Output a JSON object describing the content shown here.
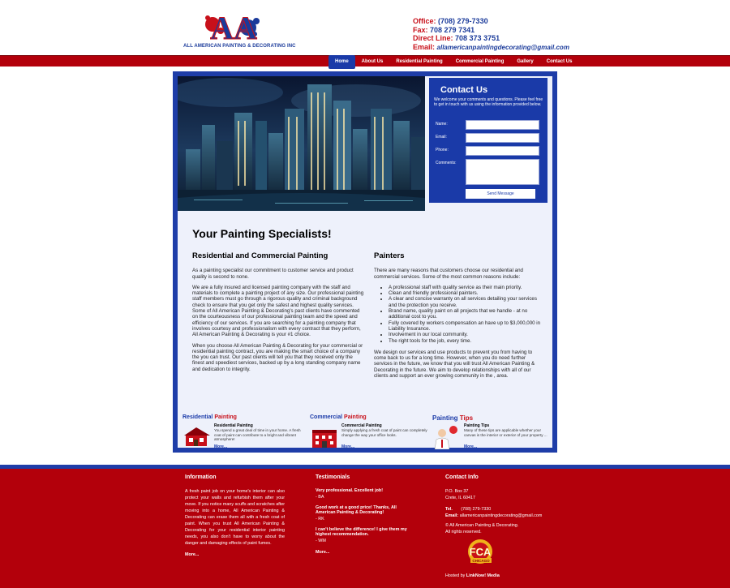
{
  "logo": {
    "text": "ALL AMERICAN PAINTING & DECORATING INC",
    "letters": "AA"
  },
  "contact_top": {
    "office_label": "Office:",
    "office": "(708) 279-7330",
    "fax_label": "Fax:",
    "fax": "708 279 7341",
    "direct_label": "Direct Line:",
    "direct": "708 373 3751",
    "email_label": "Email:",
    "email": "allamericanpaintingdecorating@gmail.com"
  },
  "nav": [
    "Home",
    "About Us",
    "Residential Painting",
    "Commercial Painting",
    "Gallery",
    "Contact Us"
  ],
  "contact_form": {
    "title": "Contact Us",
    "description": "We welcome your comments and questions. Please feel free to get in touch with us using the information provided below.",
    "labels": [
      "Name:",
      "Email:",
      "Phone:",
      "Comments:"
    ],
    "button": "Send Message"
  },
  "main": {
    "heading": "Your Painting Specialists!",
    "left": {
      "title": "Residential and Commercial Painting",
      "p1": "As a painting specialist our commitment to customer service and product quality is second to none.",
      "p2": "We are a fully insured and licensed painting company with the staff and materials to complete a painting project of any size. Our professional painting staff members must go through a rigorous quality and criminal background check to ensure that you get only the safest and highest quality services. Some of All American Painting & Decorating's past clients have commented on the courteousness of our professional painting team and the speed and efficiency of our services. If you are searching for a painting company that involves courtesy and professionalism with every contract that they perform, All American Painting & Decorating is your #1 choice.",
      "p3": "When you choose All American Painting & Decorating for your commercial or residential painting contract, you are making the smart choice of a company the you can trust. Our past clients will tell you that they received only the finest and speediest services, backed up by a long standing company name and dedication to integrity."
    },
    "right": {
      "title": "Painters",
      "p1": "There are many reasons that customers choose our residential and commercial services. Some of the most common reasons include:",
      "list": [
        "A professional staff with quality service as their main priority.",
        "Clean and friendly professional painters.",
        "A clear and concise warranty on all services detailing your services and the protection you receive.",
        "Brand name, quality paint on all projects that we handle - at no additional cost to you.",
        "Fully covered by workers compensation an have up to $3,000,000 in Liability Insurance.",
        "Involvement in our local community.",
        "The right tools for the job, every time."
      ],
      "p2": "We design our services and use products to prevent you from having to come back to us for a long time. However, when you do need further services in the future, we know that you will trust All American Painting & Decorating in the future. We aim to develop relationships with all of our clients and support an ever growing community in the , area."
    }
  },
  "features": [
    {
      "title_a": "Residential",
      "title_b": "Painting",
      "sub": "Residential Painting",
      "text": "You spend a great deal of time in your home. A fresh coat of paint can contribute to a bright and vibrant atmosphere!",
      "more": "More..."
    },
    {
      "title_a": "Commercial",
      "title_b": "Painting",
      "sub": "Commercial Painting",
      "text": "Simply applying a fresh coat of paint can completely change the way your office looks.",
      "more": "More..."
    },
    {
      "title_a": "Painting",
      "title_b": "Tips",
      "sub": "Painting Tips",
      "text": "Many of these tips are applicable whether your canvas is the interior or exterior of your property ...",
      "more": "More..."
    }
  ],
  "footer": {
    "info_title": "Information",
    "info_text": "A fresh paint job on your home's interior can also protect your walls and refurbish them after your move. If you notice many scuffs and scratches after moving into a home, All American Painting & Decorating can erase them all with a fresh coat of paint. When you trust All American Painting & Decorating for your residential interior painting needs, you also don't have to worry about the danger and damaging effects of paint fumes.",
    "info_more": "More...",
    "test_title": "Testimonials",
    "testimonials": [
      {
        "q": "Very professional. Excellent job!",
        "a": "- BA"
      },
      {
        "q": "Good work at a good price! Thanks, All American Painting & Decorating!",
        "a": "- RK"
      },
      {
        "q": "I can't believe the difference! I give them my highest recommendation.",
        "a": "- WM"
      }
    ],
    "test_more": "More...",
    "contact_title": "Contact Info",
    "address1": "P.O. Box 37",
    "address2": "Crete, IL 60417",
    "tel_label": "Tel.",
    "tel": "(708) 279-7330",
    "email_label": "Email:",
    "email": "allamericanpaintingdecorating@gmail.com",
    "copyright": "© All American Painting & Decorating.",
    "rights": "All rights reserved.",
    "fca": "FCA",
    "fca_sub": "CHICAGO",
    "hosted_prefix": "Hosted by",
    "hosted_by": "LinkNow! Media"
  },
  "colors": {
    "red": "#b3000b",
    "blue": "#1e3da8",
    "panel": "#eef1fb"
  }
}
